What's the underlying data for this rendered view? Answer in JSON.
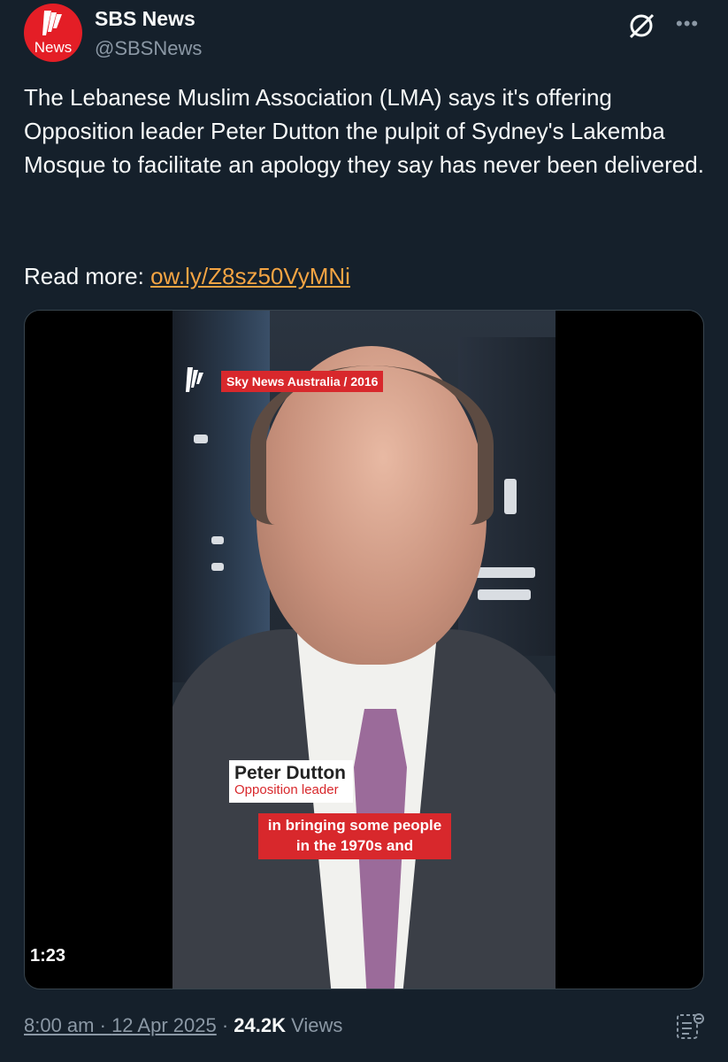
{
  "author": {
    "display_name": "SBS News",
    "handle": "@SBSNews",
    "avatar_text": "News",
    "avatar_color": "#e41e26"
  },
  "post": {
    "text": "The Lebanese Muslim Association (LMA) says it's offering Opposition leader Peter Dutton the pulpit of Sydney's Lakemba Mosque to facilitate an apology they say has never been delivered.",
    "read_more_label": "Read more: ",
    "link_text": "ow.ly/Z8sz50VyMNi",
    "link_color": "#f4a443"
  },
  "video": {
    "source_tag": "Sky News Australia / 2016",
    "lower_third_name": "Peter Dutton",
    "lower_third_title": "Opposition leader",
    "caption": "in bringing some people\nin the 1970s and",
    "duration": "1:23"
  },
  "meta": {
    "time": "8:00 am",
    "separator1": " · ",
    "date": "12 Apr 2025",
    "separator2": " · ",
    "views_count": "24.2K",
    "views_label": " Views"
  },
  "icons": {
    "grok": "grok-icon",
    "more": "more-icon",
    "summary": "summary-icon"
  }
}
